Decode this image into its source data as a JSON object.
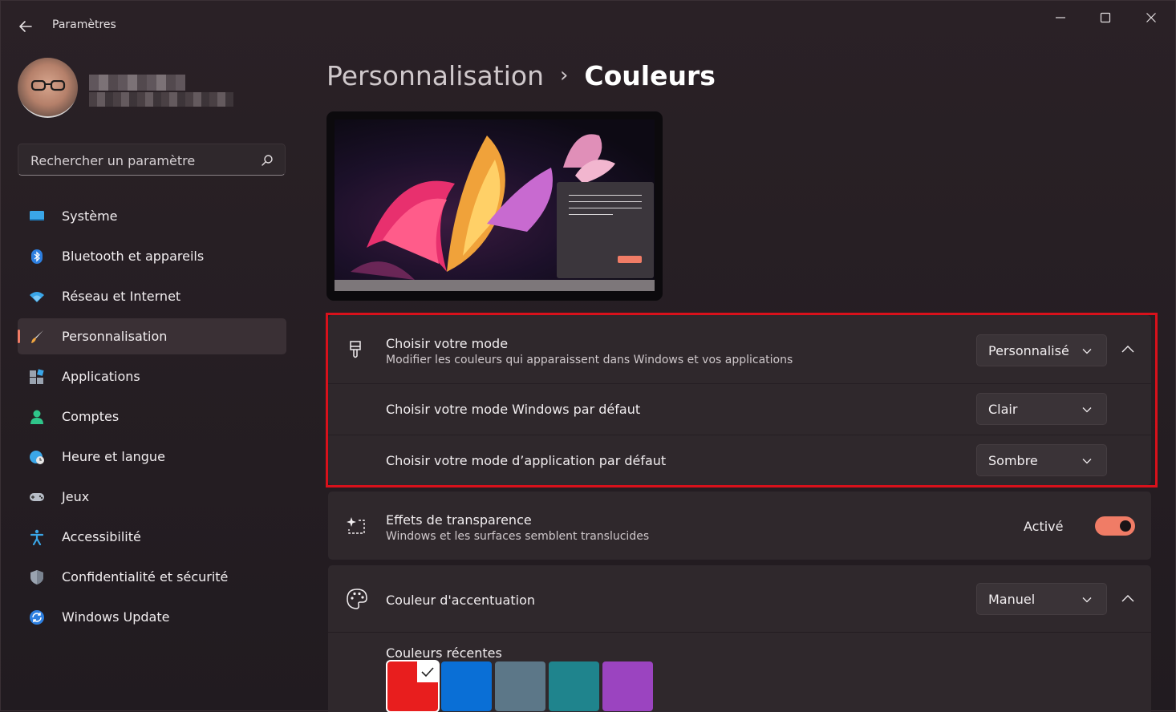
{
  "window": {
    "title": "Paramètres"
  },
  "search": {
    "placeholder": "Rechercher un paramètre"
  },
  "sidebar": {
    "items": [
      {
        "label": "Système",
        "icon": "display-icon"
      },
      {
        "label": "Bluetooth et appareils",
        "icon": "bluetooth-icon"
      },
      {
        "label": "Réseau et Internet",
        "icon": "wifi-icon"
      },
      {
        "label": "Personnalisation",
        "icon": "brush-icon",
        "selected": true
      },
      {
        "label": "Applications",
        "icon": "apps-icon"
      },
      {
        "label": "Comptes",
        "icon": "person-icon"
      },
      {
        "label": "Heure et langue",
        "icon": "globe-clock-icon"
      },
      {
        "label": "Jeux",
        "icon": "gamepad-icon"
      },
      {
        "label": "Accessibilité",
        "icon": "accessibility-icon"
      },
      {
        "label": "Confidentialité et sécurité",
        "icon": "shield-icon"
      },
      {
        "label": "Windows Update",
        "icon": "update-icon"
      }
    ]
  },
  "breadcrumb": {
    "parent": "Personnalisation",
    "separator": "›",
    "current": "Couleurs"
  },
  "mode": {
    "title": "Choisir votre mode",
    "subtitle": "Modifier les couleurs qui apparaissent dans Windows et vos applications",
    "value": "Personnalisé",
    "windows_mode": {
      "label": "Choisir votre mode Windows par défaut",
      "value": "Clair"
    },
    "app_mode": {
      "label": "Choisir votre mode d’application par défaut",
      "value": "Sombre"
    }
  },
  "transparency": {
    "title": "Effets de transparence",
    "subtitle": "Windows et les surfaces semblent translucides",
    "state_label": "Activé",
    "enabled": true
  },
  "accent": {
    "title": "Couleur d'accentuation",
    "value": "Manuel",
    "recent_label": "Couleurs récentes",
    "recent_colors": [
      "#e81e1e",
      "#0a6fd6",
      "#5c7788",
      "#1f848d",
      "#9b44c0"
    ]
  },
  "colors": {
    "accent": "#f07c66",
    "highlight": "#d8111b"
  }
}
